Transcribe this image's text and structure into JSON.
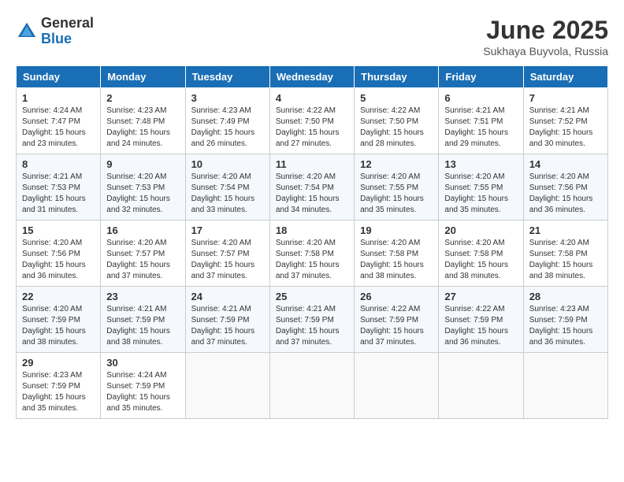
{
  "header": {
    "logo_general": "General",
    "logo_blue": "Blue",
    "month_title": "June 2025",
    "location": "Sukhaya Buyvola, Russia"
  },
  "weekdays": [
    "Sunday",
    "Monday",
    "Tuesday",
    "Wednesday",
    "Thursday",
    "Friday",
    "Saturday"
  ],
  "weeks": [
    [
      {
        "day": 1,
        "sunrise": "4:24 AM",
        "sunset": "7:47 PM",
        "daylight": "15 hours and 23 minutes."
      },
      {
        "day": 2,
        "sunrise": "4:23 AM",
        "sunset": "7:48 PM",
        "daylight": "15 hours and 24 minutes."
      },
      {
        "day": 3,
        "sunrise": "4:23 AM",
        "sunset": "7:49 PM",
        "daylight": "15 hours and 26 minutes."
      },
      {
        "day": 4,
        "sunrise": "4:22 AM",
        "sunset": "7:50 PM",
        "daylight": "15 hours and 27 minutes."
      },
      {
        "day": 5,
        "sunrise": "4:22 AM",
        "sunset": "7:50 PM",
        "daylight": "15 hours and 28 minutes."
      },
      {
        "day": 6,
        "sunrise": "4:21 AM",
        "sunset": "7:51 PM",
        "daylight": "15 hours and 29 minutes."
      },
      {
        "day": 7,
        "sunrise": "4:21 AM",
        "sunset": "7:52 PM",
        "daylight": "15 hours and 30 minutes."
      }
    ],
    [
      {
        "day": 8,
        "sunrise": "4:21 AM",
        "sunset": "7:53 PM",
        "daylight": "15 hours and 31 minutes."
      },
      {
        "day": 9,
        "sunrise": "4:20 AM",
        "sunset": "7:53 PM",
        "daylight": "15 hours and 32 minutes."
      },
      {
        "day": 10,
        "sunrise": "4:20 AM",
        "sunset": "7:54 PM",
        "daylight": "15 hours and 33 minutes."
      },
      {
        "day": 11,
        "sunrise": "4:20 AM",
        "sunset": "7:54 PM",
        "daylight": "15 hours and 34 minutes."
      },
      {
        "day": 12,
        "sunrise": "4:20 AM",
        "sunset": "7:55 PM",
        "daylight": "15 hours and 35 minutes."
      },
      {
        "day": 13,
        "sunrise": "4:20 AM",
        "sunset": "7:55 PM",
        "daylight": "15 hours and 35 minutes."
      },
      {
        "day": 14,
        "sunrise": "4:20 AM",
        "sunset": "7:56 PM",
        "daylight": "15 hours and 36 minutes."
      }
    ],
    [
      {
        "day": 15,
        "sunrise": "4:20 AM",
        "sunset": "7:56 PM",
        "daylight": "15 hours and 36 minutes."
      },
      {
        "day": 16,
        "sunrise": "4:20 AM",
        "sunset": "7:57 PM",
        "daylight": "15 hours and 37 minutes."
      },
      {
        "day": 17,
        "sunrise": "4:20 AM",
        "sunset": "7:57 PM",
        "daylight": "15 hours and 37 minutes."
      },
      {
        "day": 18,
        "sunrise": "4:20 AM",
        "sunset": "7:58 PM",
        "daylight": "15 hours and 37 minutes."
      },
      {
        "day": 19,
        "sunrise": "4:20 AM",
        "sunset": "7:58 PM",
        "daylight": "15 hours and 38 minutes."
      },
      {
        "day": 20,
        "sunrise": "4:20 AM",
        "sunset": "7:58 PM",
        "daylight": "15 hours and 38 minutes."
      },
      {
        "day": 21,
        "sunrise": "4:20 AM",
        "sunset": "7:58 PM",
        "daylight": "15 hours and 38 minutes."
      }
    ],
    [
      {
        "day": 22,
        "sunrise": "4:20 AM",
        "sunset": "7:59 PM",
        "daylight": "15 hours and 38 minutes."
      },
      {
        "day": 23,
        "sunrise": "4:21 AM",
        "sunset": "7:59 PM",
        "daylight": "15 hours and 38 minutes."
      },
      {
        "day": 24,
        "sunrise": "4:21 AM",
        "sunset": "7:59 PM",
        "daylight": "15 hours and 37 minutes."
      },
      {
        "day": 25,
        "sunrise": "4:21 AM",
        "sunset": "7:59 PM",
        "daylight": "15 hours and 37 minutes."
      },
      {
        "day": 26,
        "sunrise": "4:22 AM",
        "sunset": "7:59 PM",
        "daylight": "15 hours and 37 minutes."
      },
      {
        "day": 27,
        "sunrise": "4:22 AM",
        "sunset": "7:59 PM",
        "daylight": "15 hours and 36 minutes."
      },
      {
        "day": 28,
        "sunrise": "4:23 AM",
        "sunset": "7:59 PM",
        "daylight": "15 hours and 36 minutes."
      }
    ],
    [
      {
        "day": 29,
        "sunrise": "4:23 AM",
        "sunset": "7:59 PM",
        "daylight": "15 hours and 35 minutes."
      },
      {
        "day": 30,
        "sunrise": "4:24 AM",
        "sunset": "7:59 PM",
        "daylight": "15 hours and 35 minutes."
      },
      null,
      null,
      null,
      null,
      null
    ]
  ]
}
